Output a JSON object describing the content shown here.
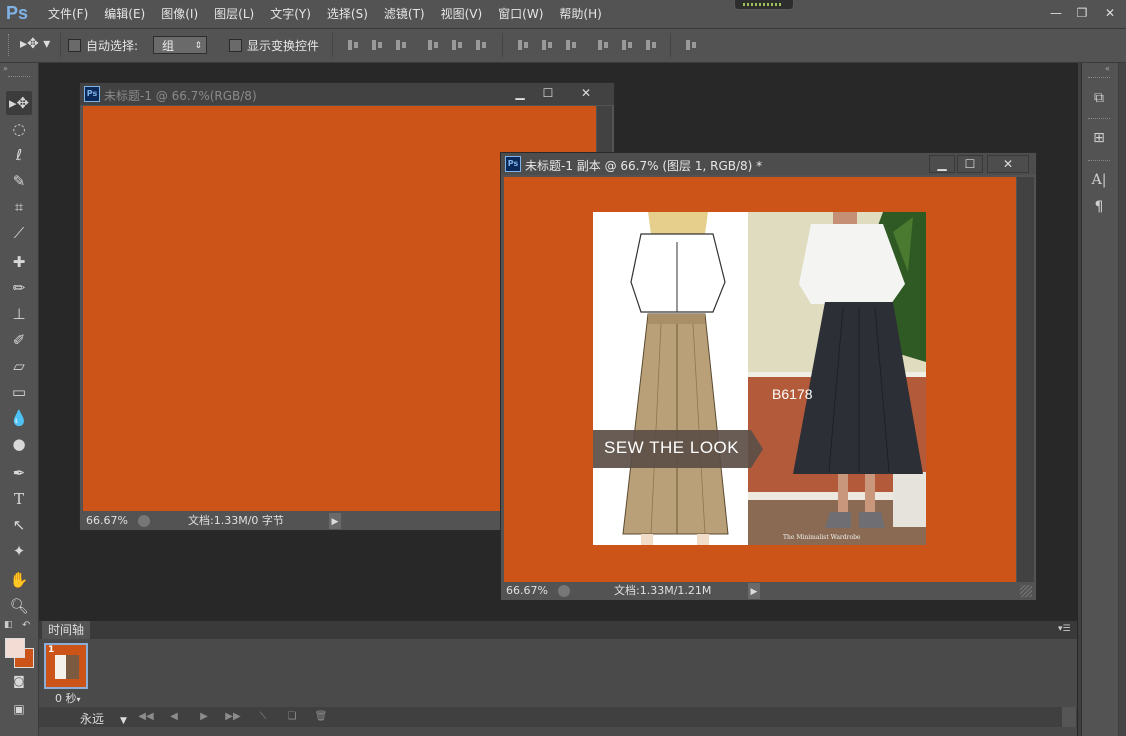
{
  "app": {
    "logo": "Ps"
  },
  "menu": {
    "items": [
      "文件(F)",
      "编辑(E)",
      "图像(I)",
      "图层(L)",
      "文字(Y)",
      "选择(S)",
      "滤镜(T)",
      "视图(V)",
      "窗口(W)",
      "帮助(H)"
    ]
  },
  "options": {
    "auto_select_label": "自动选择:",
    "auto_select_value": "组",
    "show_transform_label": "显示变换控件"
  },
  "doc1": {
    "title": "未标题-1 @ 66.7%(RGB/8)",
    "zoom": "66.67%",
    "doc_info": "文档:1.33M/0 字节"
  },
  "doc2": {
    "title": "未标题-1 副本 @ 66.7% (图层 1, RGB/8) *",
    "zoom": "66.67%",
    "doc_info": "文档:1.33M/1.21M",
    "image": {
      "banner": "SEW THE LOOK",
      "pattern_code": "B6178",
      "credit": "The Minimalist Wardrobe"
    }
  },
  "timeline": {
    "tab": "时间轴",
    "frame_number": "1",
    "frame_delay": "0 秒",
    "loop": "永远"
  },
  "colors": {
    "canvas": "#cc5418",
    "foreground": "#f2dcd4",
    "background": "#cc5418",
    "ui_panel": "#535353"
  }
}
